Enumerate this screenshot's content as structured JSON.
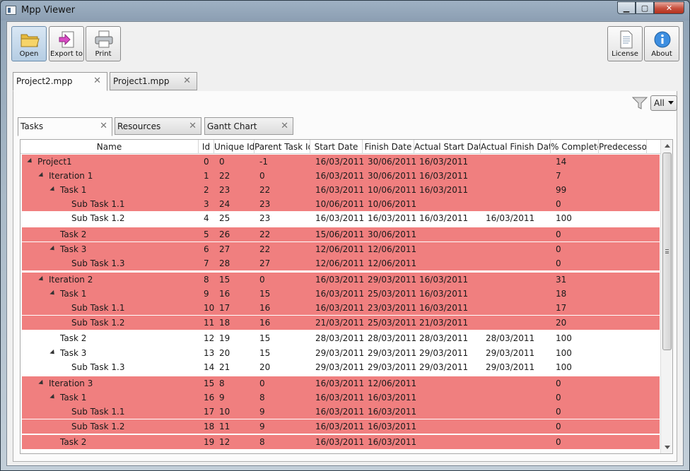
{
  "window": {
    "title": "Mpp Viewer"
  },
  "toolbar": {
    "open": "Open",
    "export": "Export to",
    "print": "Print",
    "license": "License",
    "about": "About"
  },
  "file_tabs": [
    {
      "label": "Project2.mpp",
      "active": true
    },
    {
      "label": "Project1.mpp",
      "active": false
    }
  ],
  "filter": {
    "value": "All"
  },
  "inner_tabs": [
    {
      "label": "Tasks",
      "active": true
    },
    {
      "label": "Resources",
      "active": false
    },
    {
      "label": "Gantt Chart",
      "active": false
    }
  ],
  "grid": {
    "headers": [
      "Name",
      "Id",
      "Unique Id",
      "Parent Task Id",
      "Start Date",
      "Finish Date",
      "Actual Start Date",
      "Actual Finish Date",
      "% Complete",
      "Predecessor"
    ],
    "rows": [
      {
        "name": "Project1",
        "level": 0,
        "expander": true,
        "hl": true,
        "id": "0",
        "uid": "0",
        "parent": "-1",
        "start": "16/03/2011",
        "finish": "30/06/2011",
        "astart": "16/03/2011",
        "afinish": "",
        "pct": "14",
        "pred": ""
      },
      {
        "name": "Iteration 1",
        "level": 1,
        "expander": true,
        "hl": true,
        "id": "1",
        "uid": "22",
        "parent": "0",
        "start": "16/03/2011",
        "finish": "30/06/2011",
        "astart": "16/03/2011",
        "afinish": "",
        "pct": "7",
        "pred": ""
      },
      {
        "name": "Task 1",
        "level": 2,
        "expander": true,
        "hl": true,
        "id": "2",
        "uid": "23",
        "parent": "22",
        "start": "16/03/2011",
        "finish": "10/06/2011",
        "astart": "16/03/2011",
        "afinish": "",
        "pct": "99",
        "pred": ""
      },
      {
        "name": "Sub Task 1.1",
        "level": 3,
        "expander": false,
        "hl": true,
        "id": "3",
        "uid": "24",
        "parent": "23",
        "start": "10/06/2011",
        "finish": "10/06/2011",
        "astart": "",
        "afinish": "",
        "pct": "0",
        "pred": ""
      },
      {
        "name": "Sub Task 1.2",
        "level": 3,
        "expander": false,
        "hl": false,
        "id": "4",
        "uid": "25",
        "parent": "23",
        "start": "16/03/2011",
        "finish": "16/03/2011",
        "astart": "16/03/2011",
        "afinish": "16/03/2011",
        "pct": "100",
        "pred": ""
      },
      {
        "name": "Task 2",
        "level": 2,
        "expander": false,
        "hl": true,
        "id": "5",
        "uid": "26",
        "parent": "22",
        "start": "15/06/2011",
        "finish": "30/06/2011",
        "astart": "",
        "afinish": "",
        "pct": "0",
        "pred": ""
      },
      {
        "name": "Task 3",
        "level": 2,
        "expander": true,
        "hl": true,
        "id": "6",
        "uid": "27",
        "parent": "22",
        "start": "12/06/2011",
        "finish": "12/06/2011",
        "astart": "",
        "afinish": "",
        "pct": "0",
        "pred": ""
      },
      {
        "name": "Sub Task 1.3",
        "level": 3,
        "expander": false,
        "hl": true,
        "id": "7",
        "uid": "28",
        "parent": "27",
        "start": "12/06/2011",
        "finish": "12/06/2011",
        "astart": "",
        "afinish": "",
        "pct": "0",
        "pred": ""
      },
      {
        "name": "Iteration 2",
        "level": 1,
        "expander": true,
        "hl": true,
        "id": "8",
        "uid": "15",
        "parent": "0",
        "start": "16/03/2011",
        "finish": "29/03/2011",
        "astart": "16/03/2011",
        "afinish": "",
        "pct": "31",
        "pred": ""
      },
      {
        "name": "Task 1",
        "level": 2,
        "expander": true,
        "hl": true,
        "id": "9",
        "uid": "16",
        "parent": "15",
        "start": "16/03/2011",
        "finish": "25/03/2011",
        "astart": "16/03/2011",
        "afinish": "",
        "pct": "18",
        "pred": ""
      },
      {
        "name": "Sub Task 1.1",
        "level": 3,
        "expander": false,
        "hl": true,
        "id": "10",
        "uid": "17",
        "parent": "16",
        "start": "16/03/2011",
        "finish": "23/03/2011",
        "astart": "16/03/2011",
        "afinish": "",
        "pct": "17",
        "pred": ""
      },
      {
        "name": "Sub Task 1.2",
        "level": 3,
        "expander": false,
        "hl": true,
        "id": "11",
        "uid": "18",
        "parent": "16",
        "start": "21/03/2011",
        "finish": "25/03/2011",
        "astart": "21/03/2011",
        "afinish": "",
        "pct": "20",
        "pred": ""
      },
      {
        "name": "Task 2",
        "level": 2,
        "expander": false,
        "hl": false,
        "id": "12",
        "uid": "19",
        "parent": "15",
        "start": "28/03/2011",
        "finish": "28/03/2011",
        "astart": "28/03/2011",
        "afinish": "28/03/2011",
        "pct": "100",
        "pred": ""
      },
      {
        "name": "Task 3",
        "level": 2,
        "expander": true,
        "hl": false,
        "id": "13",
        "uid": "20",
        "parent": "15",
        "start": "29/03/2011",
        "finish": "29/03/2011",
        "astart": "29/03/2011",
        "afinish": "29/03/2011",
        "pct": "100",
        "pred": ""
      },
      {
        "name": "Sub Task 1.3",
        "level": 3,
        "expander": false,
        "hl": false,
        "id": "14",
        "uid": "21",
        "parent": "20",
        "start": "29/03/2011",
        "finish": "29/03/2011",
        "astart": "29/03/2011",
        "afinish": "29/03/2011",
        "pct": "100",
        "pred": ""
      },
      {
        "name": "Iteration 3",
        "level": 1,
        "expander": true,
        "hl": true,
        "id": "15",
        "uid": "8",
        "parent": "0",
        "start": "16/03/2011",
        "finish": "12/06/2011",
        "astart": "",
        "afinish": "",
        "pct": "0",
        "pred": ""
      },
      {
        "name": "Task 1",
        "level": 2,
        "expander": true,
        "hl": true,
        "id": "16",
        "uid": "9",
        "parent": "8",
        "start": "16/03/2011",
        "finish": "16/03/2011",
        "astart": "",
        "afinish": "",
        "pct": "0",
        "pred": ""
      },
      {
        "name": "Sub Task 1.1",
        "level": 3,
        "expander": false,
        "hl": true,
        "id": "17",
        "uid": "10",
        "parent": "9",
        "start": "16/03/2011",
        "finish": "16/03/2011",
        "astart": "",
        "afinish": "",
        "pct": "0",
        "pred": ""
      },
      {
        "name": "Sub Task 1.2",
        "level": 3,
        "expander": false,
        "hl": true,
        "id": "18",
        "uid": "11",
        "parent": "9",
        "start": "16/03/2011",
        "finish": "16/03/2011",
        "astart": "",
        "afinish": "",
        "pct": "0",
        "pred": ""
      },
      {
        "name": "Task 2",
        "level": 2,
        "expander": false,
        "hl": true,
        "id": "19",
        "uid": "12",
        "parent": "8",
        "start": "16/03/2011",
        "finish": "16/03/2011",
        "astart": "",
        "afinish": "",
        "pct": "0",
        "pred": ""
      }
    ]
  },
  "colors": {
    "highlight": "#f07f7f",
    "accent": "#2a6fc9"
  },
  "icons": {
    "open": "folder-icon",
    "export": "export-icon",
    "print": "printer-icon",
    "license": "document-icon",
    "about": "info-icon",
    "filter": "funnel-icon"
  }
}
